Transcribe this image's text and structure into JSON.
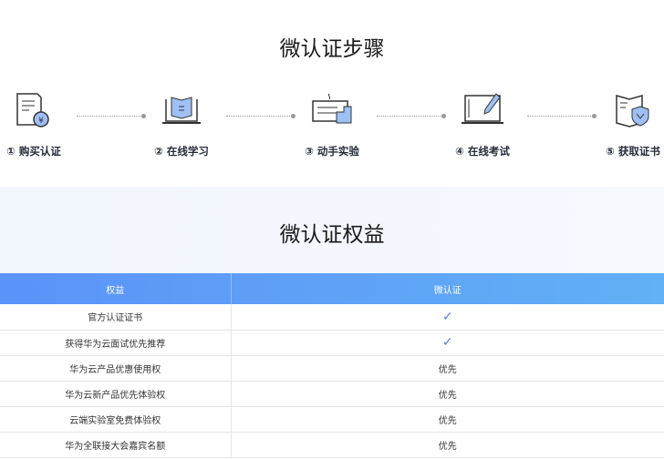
{
  "steps_title": "微认证步骤",
  "steps": [
    {
      "label": "① 购买认证",
      "icon": "document-yen-icon"
    },
    {
      "label": "② 在线学习",
      "icon": "laptop-book-icon"
    },
    {
      "label": "③ 动手实验",
      "icon": "keyboard-lab-icon"
    },
    {
      "label": "④ 在线考试",
      "icon": "laptop-pen-icon"
    },
    {
      "label": "⑤ 获取证书",
      "icon": "certificate-shield-icon"
    }
  ],
  "benefits_title": "微认证权益",
  "table": {
    "headers": [
      "权益",
      "微认证"
    ],
    "rows": [
      {
        "benefit": "官方认证证书",
        "value": "✓"
      },
      {
        "benefit": "获得华为云面试优先推荐",
        "value": "✓"
      },
      {
        "benefit": "华为云产品优惠使用权",
        "value": "优先"
      },
      {
        "benefit": "华为云新产品优先体验权",
        "value": "优先"
      },
      {
        "benefit": "云端实验室免费体验权",
        "value": "优先"
      },
      {
        "benefit": "华为全联接大会嘉宾名额",
        "value": "优先"
      }
    ]
  },
  "colors": {
    "accent": "#5b93f8",
    "check": "#4a7fe0"
  }
}
